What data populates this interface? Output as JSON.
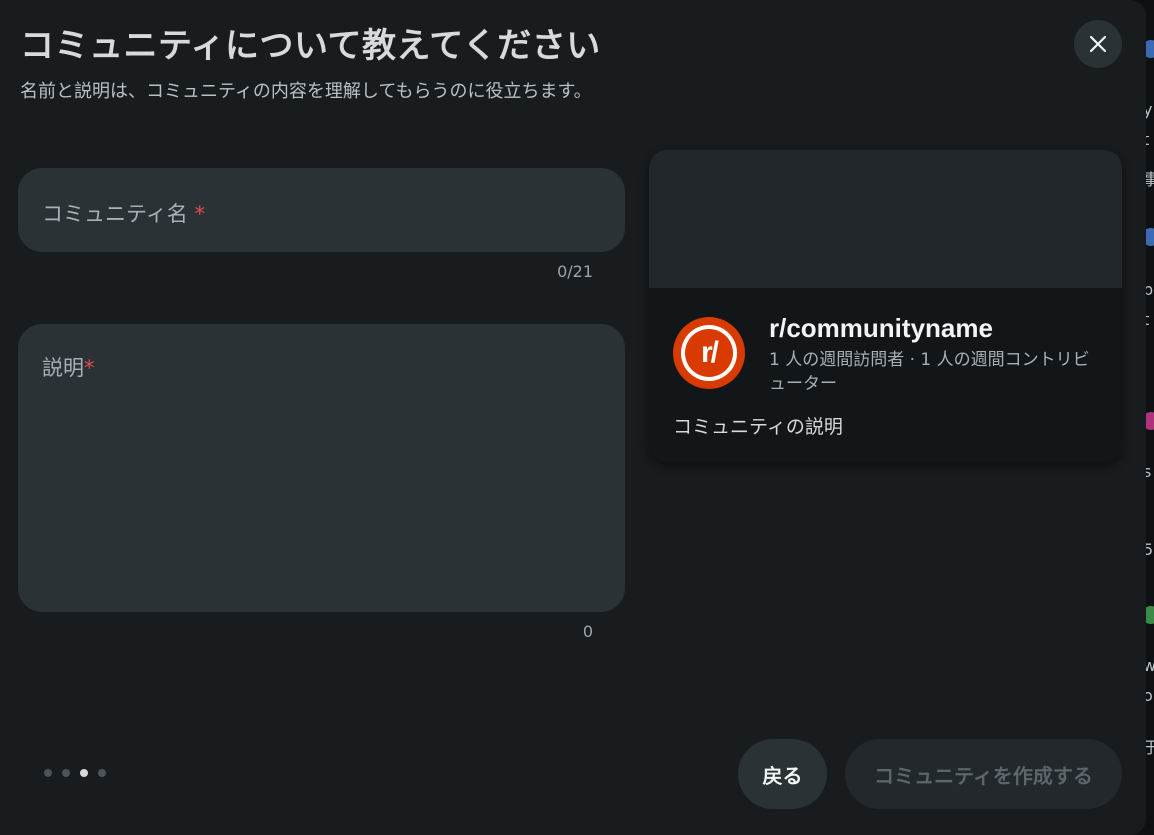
{
  "dialog": {
    "title": "コミュニティについて教えてください",
    "subtitle": "名前と説明は、コミュニティの内容を理解してもらうのに役立ちます。"
  },
  "form": {
    "name_label": "コミュニティ名",
    "name_required_mark": "*",
    "name_counter": "0/21",
    "description_label": "説明",
    "description_required_mark": "*",
    "description_counter": "0"
  },
  "preview": {
    "avatar_text": "r/",
    "community_name": "r/communityname",
    "stats": "1 人の週間訪問者 · 1 人の週間コントリビューター",
    "description": "コミュニティの説明"
  },
  "stepper": {
    "total_steps": 4,
    "current_step": 3
  },
  "buttons": {
    "back": "戻る",
    "create": "コミュニティを作成する"
  },
  "background_fragments": [
    "y",
    "t",
    "事",
    "p",
    "t",
    "s",
    "5",
    "w",
    "o",
    "于"
  ],
  "colors": {
    "modal_bg": "#181c1f",
    "field_bg": "#2a3236",
    "required": "#e24d4d",
    "avatar": "#d93a00"
  },
  "icons": {
    "close": "close-icon",
    "avatar": "reddit-community-icon"
  }
}
